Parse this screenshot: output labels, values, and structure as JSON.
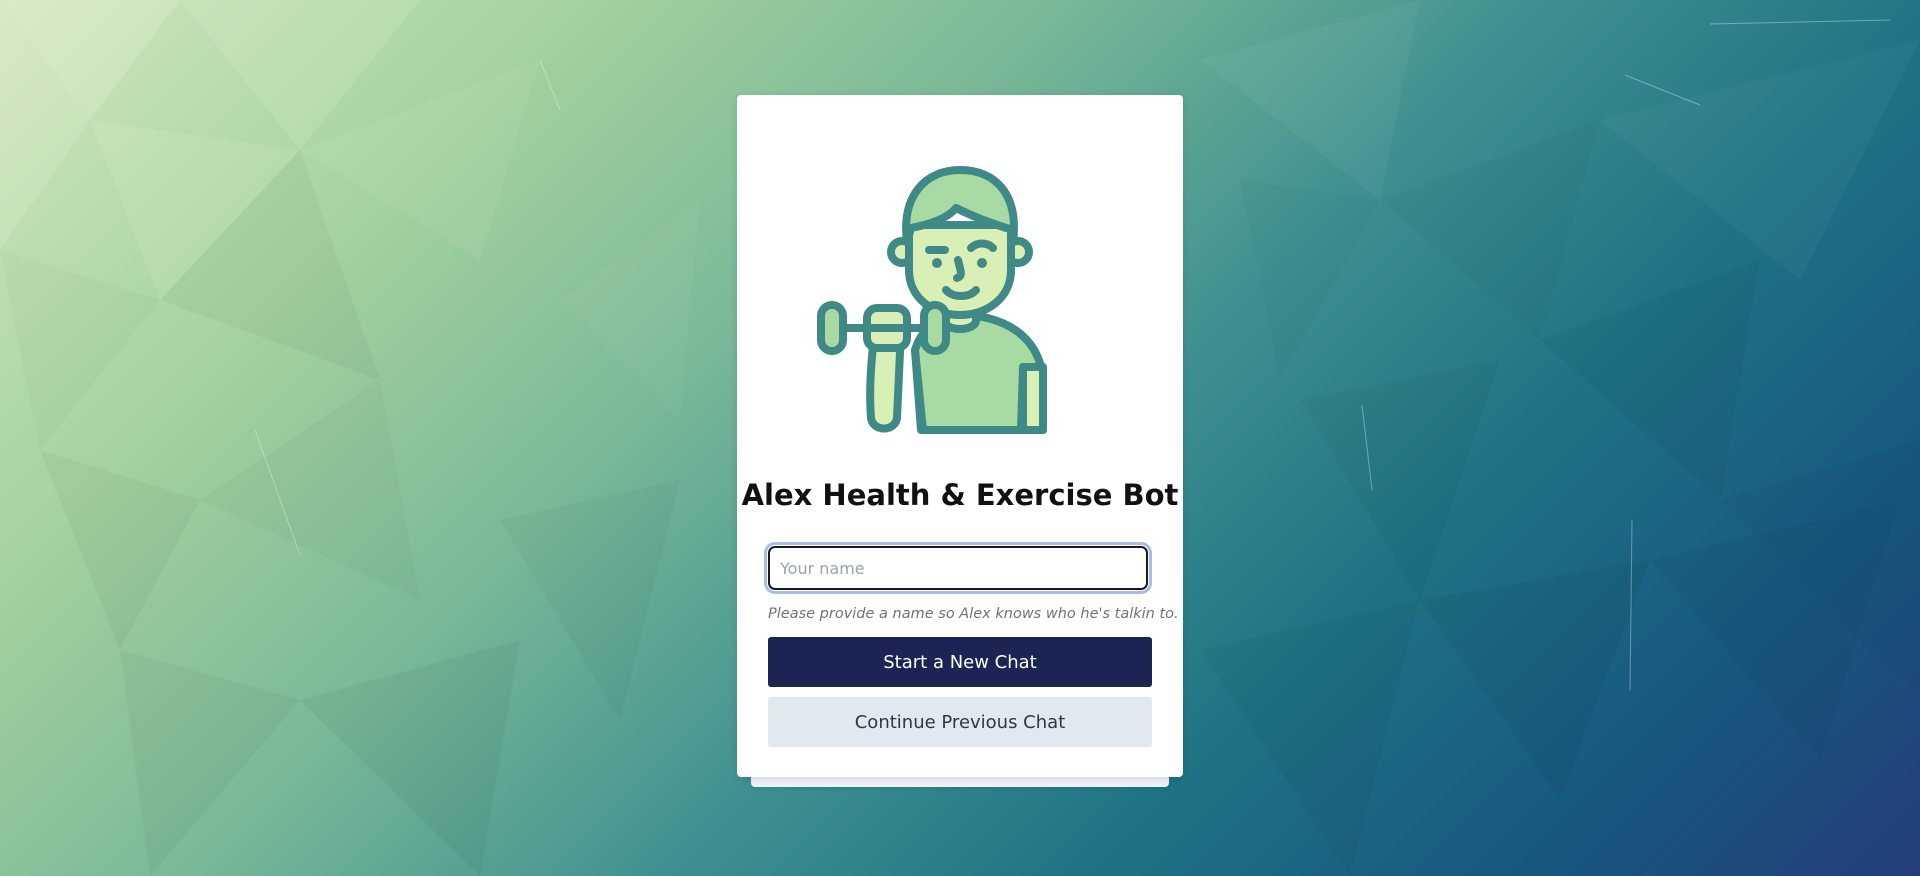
{
  "app": {
    "title": "Alex Health & Exercise Bot"
  },
  "form": {
    "name_placeholder": "Your name",
    "name_value": "",
    "hint": "Please provide a name so Alex knows who he's talkin to."
  },
  "buttons": {
    "start_label": "Start a New Chat",
    "continue_label": "Continue Previous Chat"
  },
  "icons": {
    "avatar": "man-lifting-dumbbell-icon"
  },
  "colors": {
    "primary_button": "#1b2452",
    "secondary_button": "#e2e8f0",
    "avatar_stroke": "#3f8a86",
    "avatar_fill": "#a8dba4",
    "avatar_skin": "#d8f0b5"
  }
}
